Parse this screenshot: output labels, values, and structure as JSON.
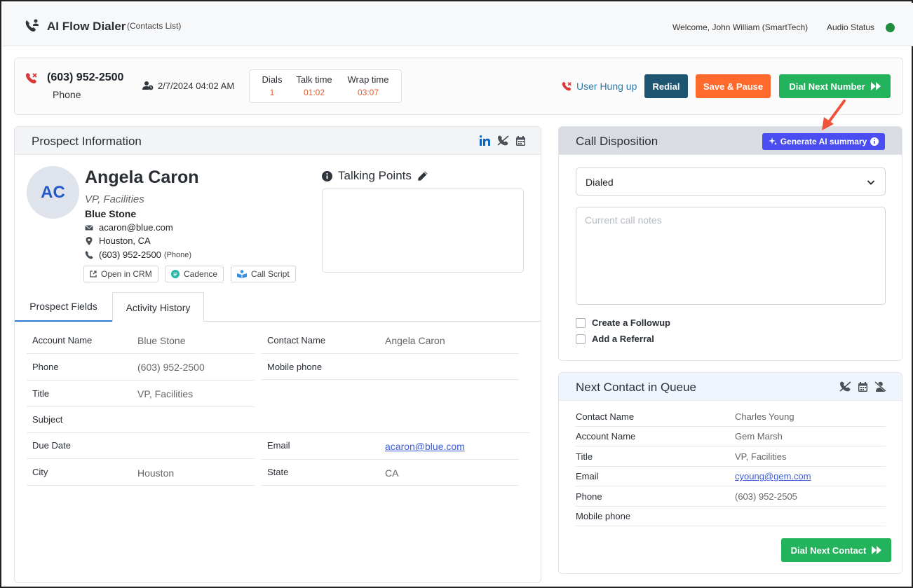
{
  "header": {
    "title": "AI Flow Dialer",
    "subtitle": "(Contacts List)",
    "welcome": "Welcome, John William (SmartTech)",
    "audio_label": "Audio Status",
    "audio_color": "#1e8e3e"
  },
  "call": {
    "number": "(603) 952-2500",
    "type": "Phone",
    "datetime": "2/7/2024 04:02 AM",
    "stats": [
      {
        "label": "Dials",
        "value": "1"
      },
      {
        "label": "Talk time",
        "value": "01:02"
      },
      {
        "label": "Wrap time",
        "value": "03:07"
      }
    ],
    "status": "User Hung up",
    "redial_label": "Redial",
    "save_pause_label": "Save & Pause",
    "dial_next_label": "Dial Next Number"
  },
  "prospect": {
    "panel_title": "Prospect Information",
    "initials": "AC",
    "name": "Angela Caron",
    "title": "VP, Facilities",
    "company": "Blue Stone",
    "email": "acaron@blue.com",
    "location": "Houston, CA",
    "phone": "(603) 952-2500",
    "phone_type": "(Phone)",
    "actions": {
      "crm": "Open in CRM",
      "cadence": "Cadence",
      "script": "Call Script"
    },
    "talking_points_title": "Talking Points",
    "tabs": [
      "Prospect Fields",
      "Activity History"
    ],
    "fields_left": [
      {
        "label": "Account Name",
        "value": "Blue Stone"
      },
      {
        "label": "Phone",
        "value": "(603) 952-2500"
      },
      {
        "label": "Title",
        "value": "VP, Facilities"
      },
      {
        "label": "Subject",
        "value": ""
      },
      {
        "label": "Due Date",
        "value": ""
      },
      {
        "label": "City",
        "value": "Houston"
      }
    ],
    "fields_right": [
      {
        "label": "Contact Name",
        "value": "Angela Caron"
      },
      {
        "label": "Mobile phone",
        "value": ""
      },
      {
        "label": "Email",
        "value": "acaron@blue.com"
      },
      {
        "label": "State",
        "value": "CA"
      }
    ]
  },
  "disposition": {
    "panel_title": "Call Disposition",
    "ai_button": "Generate AI summary",
    "selected": "Dialed",
    "notes_placeholder": "Current call notes",
    "followup_label": "Create a Followup",
    "referral_label": "Add a Referral"
  },
  "queue": {
    "panel_title": "Next Contact in Queue",
    "rows": [
      {
        "label": "Contact Name",
        "value": "Charles Young"
      },
      {
        "label": "Account Name",
        "value": "Gem Marsh"
      },
      {
        "label": "Title",
        "value": "VP, Facilities"
      },
      {
        "label": "Email",
        "value": "cyoung@gem.com"
      },
      {
        "label": "Phone",
        "value": "(603) 952-2505"
      },
      {
        "label": "Mobile phone",
        "value": ""
      }
    ],
    "dial_next_contact_label": "Dial Next Contact"
  }
}
